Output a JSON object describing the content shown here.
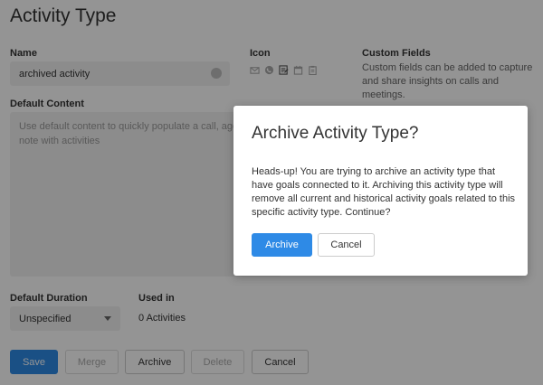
{
  "page": {
    "title": "Activity Type"
  },
  "form": {
    "name_label": "Name",
    "name_value": "archived activity",
    "icon_label": "Icon",
    "icons": [
      "envelope-icon",
      "phone-icon",
      "note-icon",
      "calendar-icon",
      "clipboard-icon"
    ],
    "custom_fields_label": "Custom Fields",
    "custom_fields_desc": "Custom fields can be added to capture and share insights on calls and meetings.",
    "default_content_label": "Default Content",
    "default_content_placeholder": "Use default content to quickly populate a call, agenda, or note with activities",
    "default_duration_label": "Default Duration",
    "default_duration_value": "Unspecified",
    "used_in_label": "Used in",
    "used_in_value": "0 Activities"
  },
  "footer_buttons": {
    "save": "Save",
    "merge": "Merge",
    "archive": "Archive",
    "delete": "Delete",
    "cancel": "Cancel"
  },
  "modal": {
    "title": "Archive Activity Type?",
    "body": "Heads-up! You are trying to archive an activity type that have goals connected to it. Archiving this activity type will remove all current and historical activity goals related to this specific activity type. Continue?",
    "confirm": "Archive",
    "cancel": "Cancel"
  },
  "colors": {
    "primary": "#2e8ae6",
    "overlay": "rgba(0,0,0,0.42)"
  }
}
